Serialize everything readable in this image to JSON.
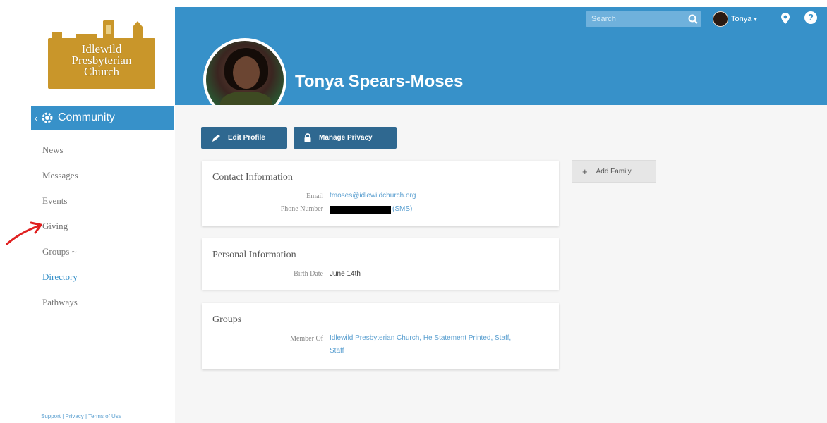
{
  "logo": {
    "lines": [
      "Idlewild",
      "Presbyterian",
      "Church"
    ]
  },
  "sidebar": {
    "section": "Community",
    "items": [
      {
        "label": "News",
        "active": false
      },
      {
        "label": "Messages",
        "active": false
      },
      {
        "label": "Events",
        "active": false
      },
      {
        "label": "Giving",
        "active": false
      },
      {
        "label": "Groups ~",
        "active": false
      },
      {
        "label": "Directory",
        "active": true
      },
      {
        "label": "Pathways",
        "active": false
      }
    ],
    "footer": "Support | Privacy | Terms of Use"
  },
  "header": {
    "search_placeholder": "Search",
    "user_name": "Tonya",
    "profile_name": "Tonya Spears-Moses"
  },
  "actions": {
    "edit_profile": "Edit Profile",
    "manage_privacy": "Manage Privacy",
    "add_family": "Add Family"
  },
  "contact": {
    "title": "Contact Information",
    "email_label": "Email",
    "email_value": "tmoses@idlewildchurch.org",
    "phone_label": "Phone Number",
    "phone_suffix": "(SMS)"
  },
  "personal": {
    "title": "Personal Information",
    "birth_label": "Birth Date",
    "birth_value": "June 14th"
  },
  "groups": {
    "title": "Groups",
    "member_label": "Member Of",
    "member_line1": "Idlewild Presbyterian Church, He Statement Printed, Staff,",
    "member_line2": "Staff"
  },
  "colors": {
    "primary": "#3791c9",
    "button_dark": "#2f6890",
    "logo_gold": "#c9962a",
    "arrow": "#e02020"
  }
}
